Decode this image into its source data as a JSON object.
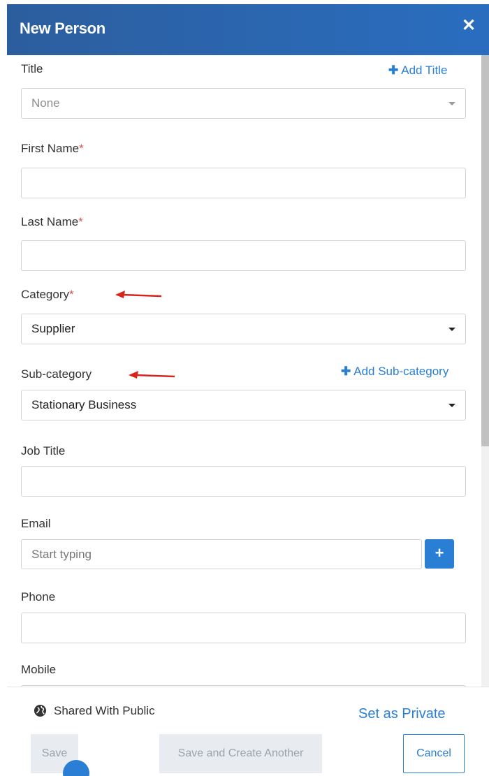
{
  "header": {
    "title": "New Person",
    "close_icon": "close-icon"
  },
  "form": {
    "title": {
      "label": "Title",
      "add_link": "Add Title",
      "value": "None"
    },
    "first_name": {
      "label": "First Name",
      "required_mark": "*",
      "value": ""
    },
    "last_name": {
      "label": "Last Name",
      "required_mark": "*",
      "value": ""
    },
    "category": {
      "label": "Category",
      "required_mark": "*",
      "value": "Supplier"
    },
    "sub_category": {
      "label": "Sub-category",
      "add_link": "Add Sub-category",
      "value": "Stationary Business"
    },
    "job_title": {
      "label": "Job Title",
      "value": ""
    },
    "email": {
      "label": "Email",
      "placeholder": "Start typing",
      "add_button": "+"
    },
    "phone": {
      "label": "Phone",
      "value": ""
    },
    "mobile": {
      "label": "Mobile",
      "value": ""
    }
  },
  "annotations": {
    "arrow_color": "#d9231d"
  },
  "footer": {
    "sharing_text": "Shared With Public",
    "sharing_icon": "globe-icon",
    "private_link": "Set as Private",
    "save_label": "Save",
    "save_another_label": "Save and Create Another",
    "cancel_label": "Cancel"
  },
  "colors": {
    "header_start": "#2c5e9e",
    "header_end": "#2a6dbf",
    "accent": "#2a7fd4",
    "required": "#d9534f"
  }
}
